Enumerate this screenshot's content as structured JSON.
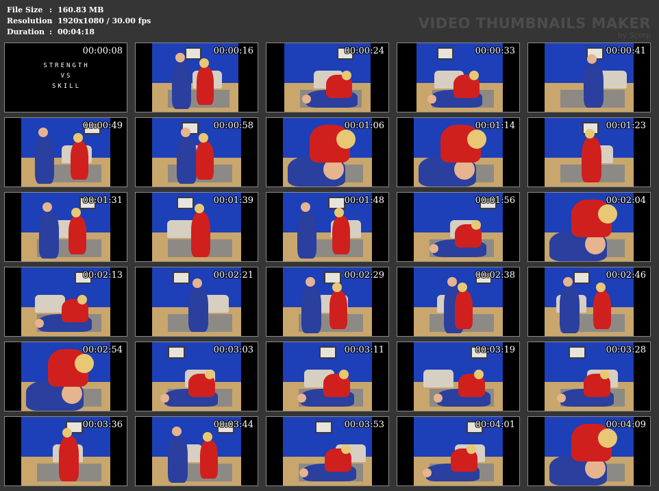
{
  "meta": {
    "rows": [
      {
        "key": "File Size",
        "value": "160.83 MB"
      },
      {
        "key": "Resolution",
        "value": "1920x1080 / 30.00 fps"
      },
      {
        "key": "Duration",
        "value": "00:04:18"
      }
    ],
    "separator": ":"
  },
  "brand": {
    "title": "VIDEO THUMBNAILS MAKER",
    "subtitle": "by Scorp"
  },
  "title_card": [
    "STRENGTH",
    "VS",
    "SKILL"
  ],
  "thumbnails": [
    {
      "time": "00:00:08"
    },
    {
      "time": "00:00:16"
    },
    {
      "time": "00:00:24"
    },
    {
      "time": "00:00:33"
    },
    {
      "time": "00:00:41"
    },
    {
      "time": "00:00:49"
    },
    {
      "time": "00:00:58"
    },
    {
      "time": "00:01:06"
    },
    {
      "time": "00:01:14"
    },
    {
      "time": "00:01:23"
    },
    {
      "time": "00:01:31"
    },
    {
      "time": "00:01:39"
    },
    {
      "time": "00:01:48"
    },
    {
      "time": "00:01:56"
    },
    {
      "time": "00:02:04"
    },
    {
      "time": "00:02:13"
    },
    {
      "time": "00:02:21"
    },
    {
      "time": "00:02:29"
    },
    {
      "time": "00:02:38"
    },
    {
      "time": "00:02:46"
    },
    {
      "time": "00:02:54"
    },
    {
      "time": "00:03:03"
    },
    {
      "time": "00:03:11"
    },
    {
      "time": "00:03:19"
    },
    {
      "time": "00:03:28"
    },
    {
      "time": "00:03:36"
    },
    {
      "time": "00:03:44"
    },
    {
      "time": "00:03:53"
    },
    {
      "time": "00:04:01"
    },
    {
      "time": "00:04:09"
    }
  ],
  "colors": {
    "background": "#353535",
    "wall_blue": "#1d3fb8",
    "floor": "#c9a66b",
    "gi_blue": "#2a3f9e",
    "gi_red": "#d0201e",
    "skin": "#e6b48f",
    "hair": "#e8c873"
  }
}
